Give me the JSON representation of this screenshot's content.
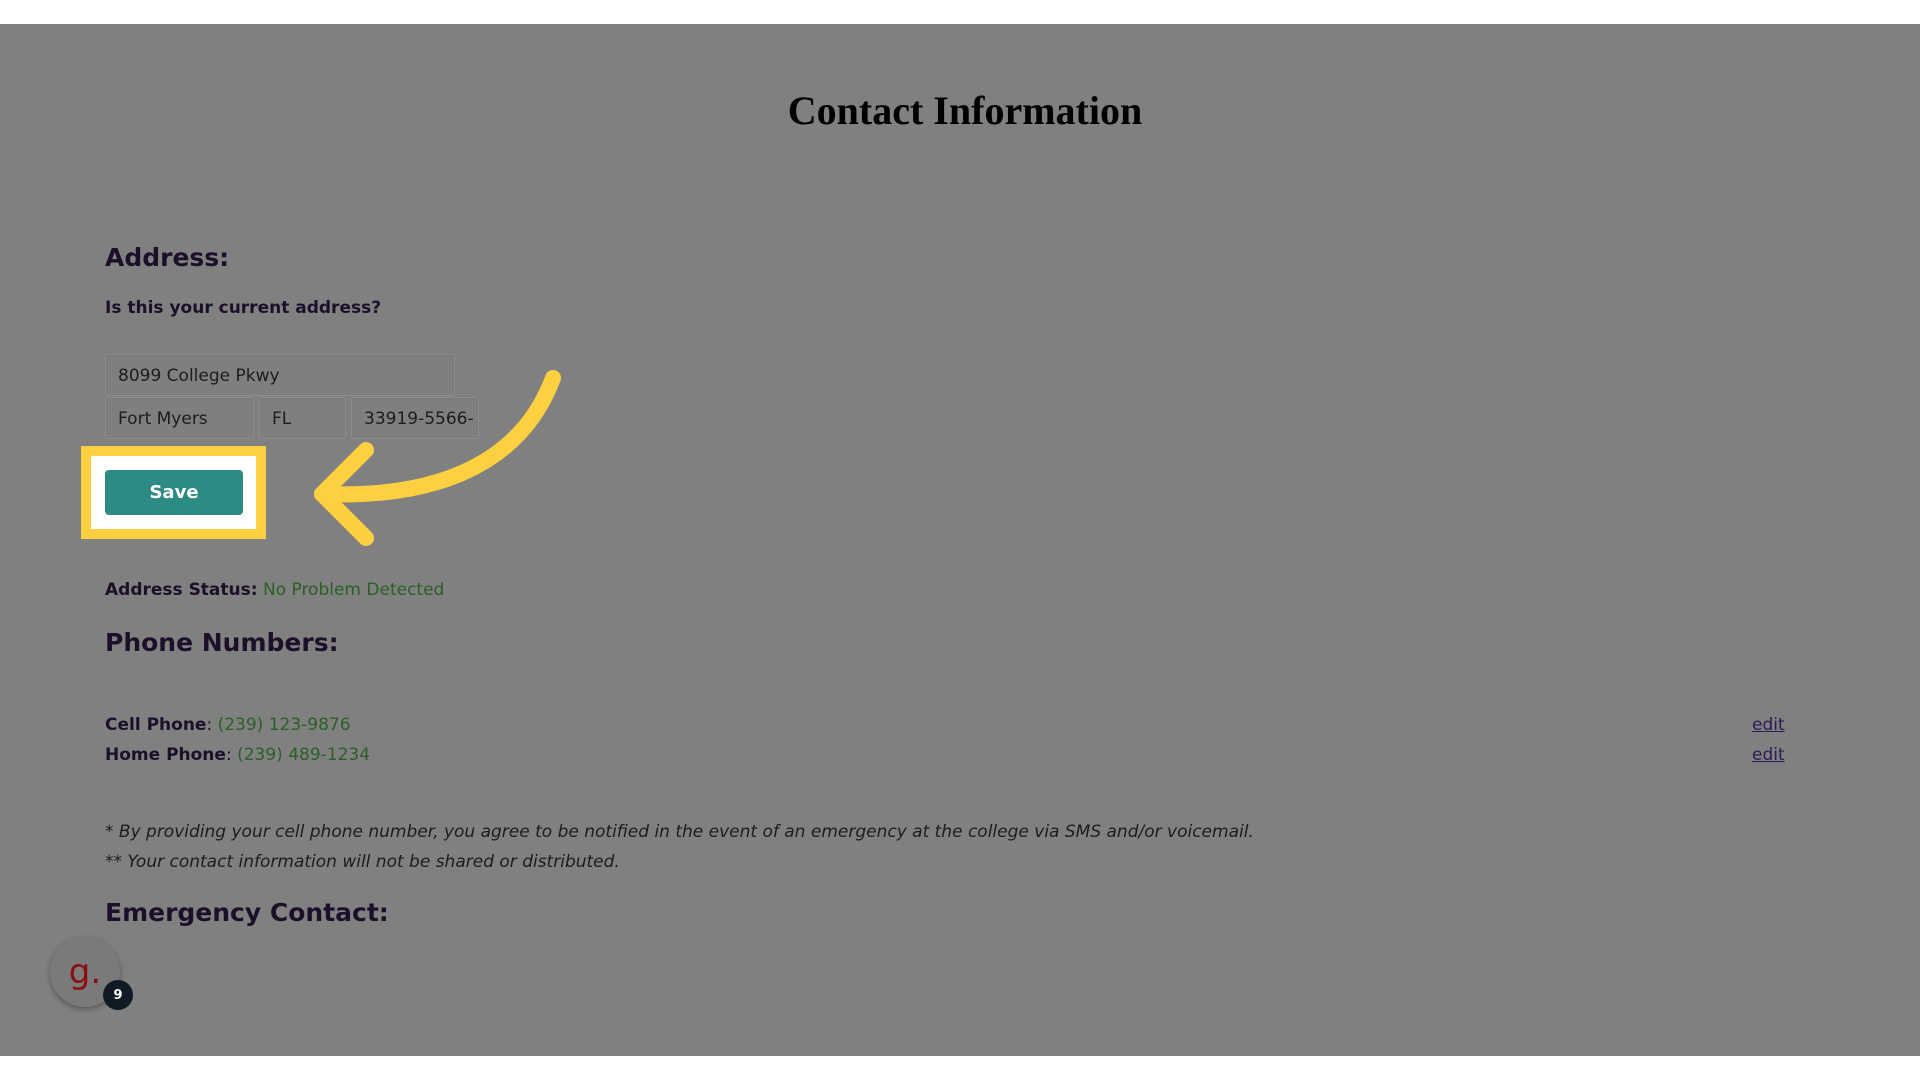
{
  "page": {
    "title": "Contact Information"
  },
  "address": {
    "heading": "Address:",
    "question": "Is this your current address?",
    "street": "8099 College Pkwy",
    "city": "Fort Myers",
    "state": "FL",
    "zip": "33919-5566-",
    "save_label": "Save",
    "status_label": "Address Status:",
    "status_value": "No Problem Detected"
  },
  "phones": {
    "heading": "Phone Numbers:",
    "items": [
      {
        "label": "Cell Phone",
        "value": "(239) 123-9876",
        "edit_label": "edit"
      },
      {
        "label": "Home Phone",
        "value": "(239) 489-1234",
        "edit_label": "edit"
      }
    ],
    "separator": ": "
  },
  "notes": {
    "line1": "* By providing your cell phone number, you agree to be notified in the event of an emergency at the college via SMS and/or voicemail.",
    "line2": "** Your contact information will not be shared or distributed."
  },
  "emergency": {
    "heading": "Emergency Contact:"
  },
  "widget": {
    "avatar_letter": "g.",
    "badge_count": "9"
  },
  "colors": {
    "overlay": "#808080",
    "highlight": "#fcd041",
    "save_button": "#2e8b84",
    "status_green": "#2a5f26"
  },
  "icons": {
    "arrow": "curved-arrow-icon"
  }
}
